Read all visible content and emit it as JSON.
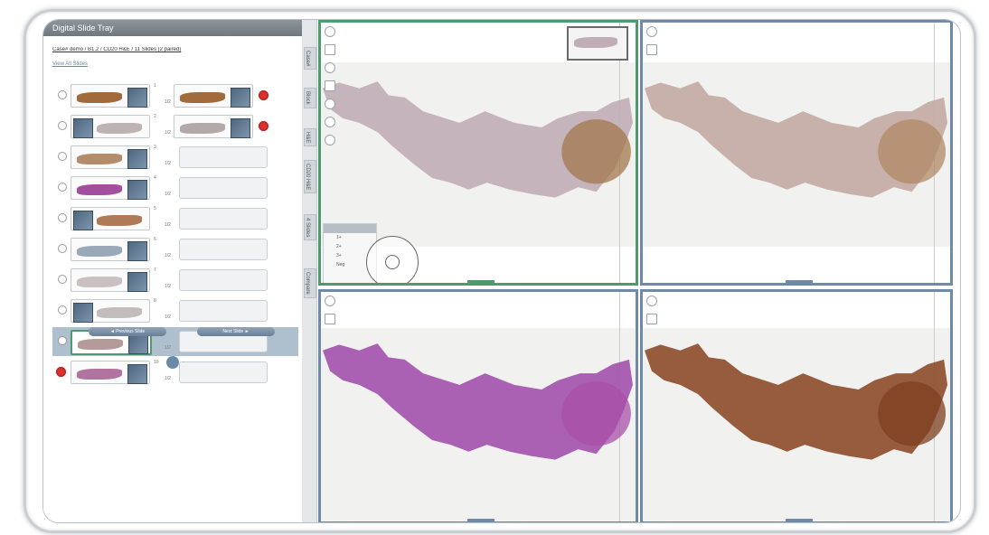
{
  "app": {
    "panel_title": "Digital Slide Tray",
    "case_title": "Case# demo / B1.2 / CD20 H&E / 11 Slides (2 paired)",
    "slides_link": "View All Slides"
  },
  "slide_rows": [
    {
      "pair_num": "1",
      "pair_sub": "1/2",
      "left_stain": "#a06a3a",
      "right_stain": "#a26b3e",
      "has_pair": true,
      "removable": true
    },
    {
      "pair_num": "2",
      "pair_sub": "1/2",
      "left_stain": "#bdb3b3",
      "right_stain": "#b3a9aa",
      "has_pair": true,
      "removable": true
    },
    {
      "pair_num": "3",
      "pair_sub": "1/2",
      "left_stain": "#b38c6c",
      "right_stain": null,
      "has_pair": false,
      "removable": false
    },
    {
      "pair_num": "4",
      "pair_sub": "1/2",
      "left_stain": "#a34f9e",
      "right_stain": null,
      "has_pair": false,
      "removable": false
    },
    {
      "pair_num": "5",
      "pair_sub": "1/2",
      "left_stain": "#b07a56",
      "right_stain": null,
      "has_pair": false,
      "removable": false
    },
    {
      "pair_num": "6",
      "pair_sub": "1/2",
      "left_stain": "#9aa9b8",
      "right_stain": null,
      "has_pair": false,
      "removable": false
    },
    {
      "pair_num": "7",
      "pair_sub": "1/2",
      "left_stain": "#c8c0c1",
      "right_stain": null,
      "has_pair": false,
      "removable": false
    },
    {
      "pair_num": "8",
      "pair_sub": "1/2",
      "left_stain": "#c2bcbc",
      "right_stain": null,
      "has_pair": false,
      "removable": false
    },
    {
      "pair_num": "9",
      "pair_sub": "1/2",
      "left_stain": "#b59a9a",
      "right_stain": null,
      "has_pair": false,
      "removable": false,
      "active": true
    },
    {
      "pair_num": "10",
      "pair_sub": "1/2",
      "left_stain": "#b0749f",
      "right_stain": null,
      "has_pair": false,
      "removable": true
    }
  ],
  "buttons": {
    "previous": "◄ Previous Slide",
    "next": "Next Slide ►"
  },
  "pager": {
    "dots_left": "·",
    "dots_right": "·"
  },
  "vertical_tabs": [
    "Case#",
    "Block",
    "H&E",
    "CD20 H&E",
    "4 Slides",
    "Compare"
  ],
  "viewers": [
    {
      "name": "viewer-top-left",
      "tissue_color": "#c0adb5",
      "accent": "#a3774c",
      "active": true
    },
    {
      "name": "viewer-top-right",
      "tissue_color": "#c3aaa3",
      "accent": "#b08864",
      "active": false
    },
    {
      "name": "viewer-bottom-left",
      "tissue_color": "#a250ac",
      "accent": "#a84fa8",
      "active": false
    },
    {
      "name": "viewer-bottom-right",
      "tissue_color": "#8d4a2a",
      "accent": "#7e3f20",
      "active": false
    }
  ],
  "legend_rows": [
    "1+",
    "2+",
    "3+",
    "Neg"
  ],
  "colors": {
    "active_border": "#4e9a6d",
    "inactive_border": "#6e8aa6",
    "remove_red": "#d9322f"
  }
}
